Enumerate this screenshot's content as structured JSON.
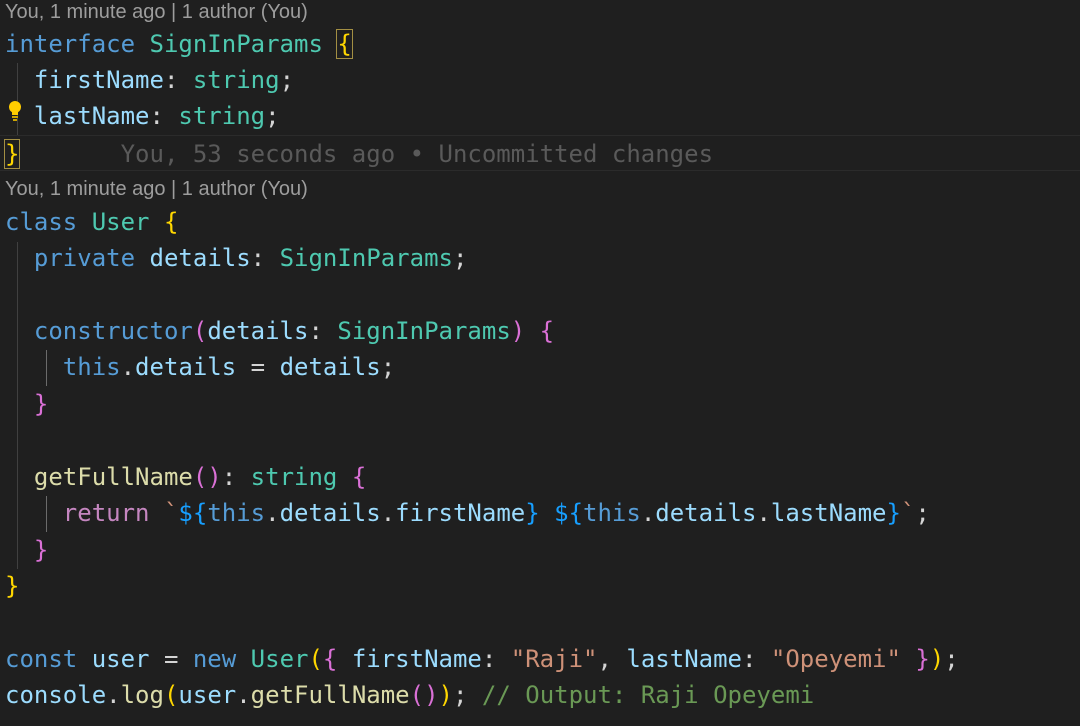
{
  "codelens": {
    "interface": "You, 1 minute ago | 1 author (You)",
    "class": "You, 1 minute ago | 1 author (You)"
  },
  "blame_inline": "You, 53 seconds ago • Uncommitted changes",
  "icons": {
    "lightbulb": "lightbulb-icon"
  },
  "colors": {
    "background": "#1f1f1f",
    "keyword": "#569cd6",
    "control_keyword": "#c586c0",
    "type": "#4ec9b0",
    "property": "#9cdcfe",
    "function": "#dcdcaa",
    "string": "#ce9178",
    "comment": "#6a9955",
    "bracket_level1": "#ffd700",
    "bracket_level2": "#da70d6",
    "bracket_level3": "#179fff",
    "lightbulb": "#ffcc00"
  },
  "code": {
    "l1": {
      "kw": "interface",
      "name": "SignInParams",
      "open": "{"
    },
    "l2": {
      "prop": "firstName",
      "colon": ":",
      "type": "string",
      "semi": ";"
    },
    "l3": {
      "prop": "lastName",
      "colon": ":",
      "type": "string",
      "semi": ";"
    },
    "l4": {
      "close": "}"
    },
    "l5": {
      "kw": "class",
      "name": "User",
      "open": "{"
    },
    "l6": {
      "kw": "private",
      "prop": "details",
      "colon": ":",
      "type": "SignInParams",
      "semi": ";"
    },
    "l8": {
      "fn": "constructor",
      "popen": "(",
      "param": "details",
      "colon": ":",
      "type": "SignInParams",
      "pclose": ")",
      "open": "{"
    },
    "l9": {
      "this": "this",
      "dot": ".",
      "prop": "details",
      "eq": " = ",
      "val": "details",
      "semi": ";"
    },
    "l10": {
      "close": "}"
    },
    "l12": {
      "fn": "getFullName",
      "parens": "()",
      "colon": ":",
      "type": "string",
      "open": "{"
    },
    "l13": {
      "ret": "return",
      "tick1": "`",
      "i1open": "${",
      "i1this": "this",
      "i1dot1": ".",
      "i1details": "details",
      "i1dot2": ".",
      "i1prop": "firstName",
      "i1close": "}",
      "space": " ",
      "i2open": "${",
      "i2this": "this",
      "i2dot1": ".",
      "i2details": "details",
      "i2dot2": ".",
      "i2prop": "lastName",
      "i2close": "}",
      "tick2": "`",
      "semi": ";"
    },
    "l14": {
      "close": "}"
    },
    "l15": {
      "close": "}"
    },
    "l17": {
      "kw": "const",
      "var": "user",
      "eq": " = ",
      "new": "new",
      "cls": "User",
      "popen": "(",
      "bopen": "{",
      "p1": "firstName",
      "c1": ":",
      "v1": "\"Raji\"",
      "comma": ",",
      "p2": "lastName",
      "c2": ":",
      "v2": "\"Opeyemi\"",
      "bclose": "}",
      "pclose": ")",
      "semi": ";"
    },
    "l18": {
      "obj": "console",
      "dot1": ".",
      "method": "log",
      "popen": "(",
      "var": "user",
      "dot2": ".",
      "fn": "getFullName",
      "inner": "()",
      "pclose": ")",
      "semi": ";",
      "comment": "// Output: Raji Opeyemi"
    }
  }
}
